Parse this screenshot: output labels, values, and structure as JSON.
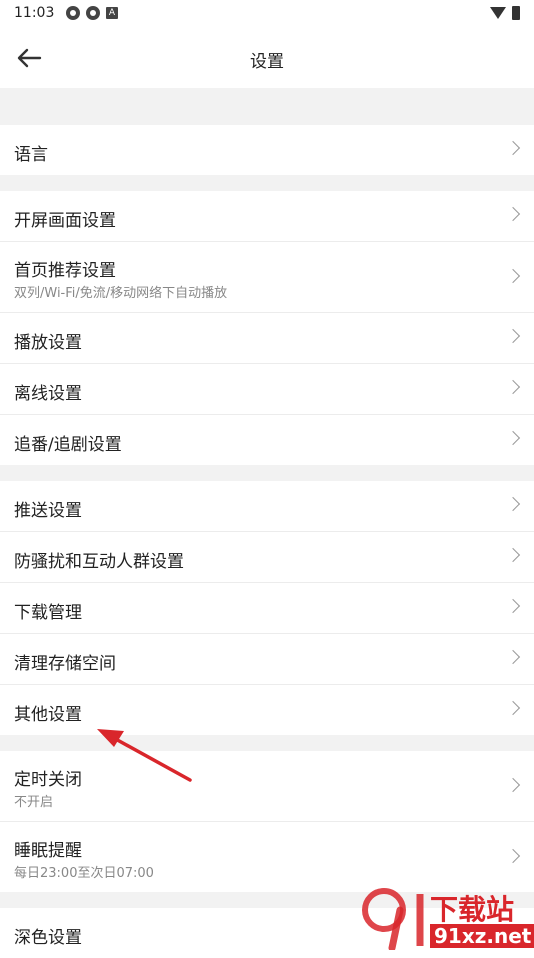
{
  "status_bar": {
    "time": "11:03",
    "icons": [
      "sync-icon",
      "sync-icon",
      "a-icon"
    ]
  },
  "header": {
    "title": "设置",
    "back_icon": "arrow-left-icon"
  },
  "groups": [
    {
      "items": [
        {
          "label": "语言"
        }
      ]
    },
    {
      "items": [
        {
          "label": "开屏画面设置"
        },
        {
          "label": "首页推荐设置",
          "sub": "双列/Wi-Fi/免流/移动网络下自动播放"
        },
        {
          "label": "播放设置"
        },
        {
          "label": "离线设置"
        },
        {
          "label": "追番/追剧设置"
        }
      ]
    },
    {
      "items": [
        {
          "label": "推送设置"
        },
        {
          "label": "防骚扰和互动人群设置"
        },
        {
          "label": "下载管理"
        },
        {
          "label": "清理存储空间"
        },
        {
          "label": "其他设置"
        }
      ]
    },
    {
      "items": [
        {
          "label": "定时关闭",
          "sub": "不开启"
        },
        {
          "label": "睡眠提醒",
          "sub": "每日23:00至次日07:00"
        }
      ]
    },
    {
      "items": [
        {
          "label": "深色设置"
        }
      ]
    }
  ],
  "watermark": {
    "brand_text": "下载站",
    "domain_text": "91xz.net"
  },
  "colors": {
    "annotation_arrow": "#d9262b",
    "watermark": "#d9262b"
  }
}
